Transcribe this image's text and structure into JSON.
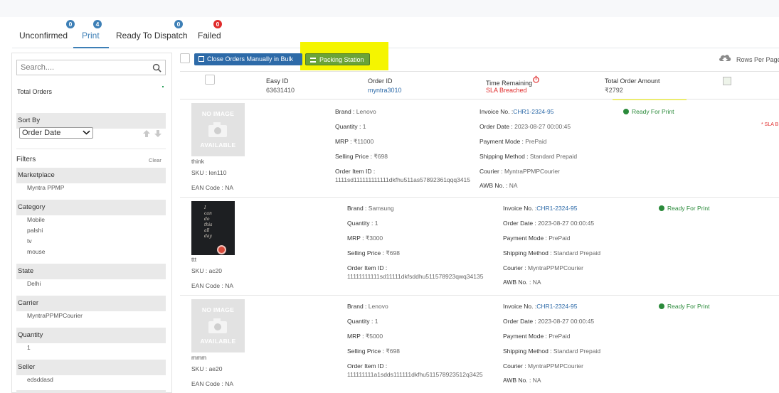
{
  "tabs": [
    {
      "label": "Unconfirmed",
      "count": "0",
      "color": "#3d7fb6"
    },
    {
      "label": "Print",
      "count": "4",
      "color": "#3d7fb6",
      "active": true
    },
    {
      "label": "Ready To Dispatch",
      "count": "0",
      "color": "#3d7fb6"
    },
    {
      "label": "Failed",
      "count": "0",
      "color": "#e02b2b"
    }
  ],
  "sidebar": {
    "search_placeholder": "Search....",
    "total_orders_label": "Total Orders",
    "sort_by_label": "Sort By",
    "sort_value": "Order Date",
    "filters_label": "Filters",
    "clear_label": "Clear",
    "groups": [
      {
        "title": "Marketplace",
        "items": [
          "Myntra PPMP"
        ]
      },
      {
        "title": "Category",
        "items": [
          "Mobile",
          "palshi",
          "tv",
          "mouse"
        ]
      },
      {
        "title": "State",
        "items": [
          "Delhi"
        ]
      },
      {
        "title": "Carrier",
        "items": [
          "MyntraPPMPCourier"
        ]
      },
      {
        "title": "Quantity",
        "items": [
          "1"
        ]
      },
      {
        "title": "Seller",
        "items": [
          "edsddasd"
        ]
      }
    ]
  },
  "toolbar": {
    "close_bulk_label": "Close Orders Manually in Bulk",
    "packing_station_label": "Packing Station",
    "rows_per_page_label": "Rows Per Page"
  },
  "order": {
    "easy_id_label": "Easy ID",
    "easy_id": "63631410",
    "order_id_label": "Order ID",
    "order_id": "myntra3010",
    "time_remaining_label": "Time Remaining",
    "time_remaining_value": "SLA Breached",
    "total_amount_label": "Total Order Amount",
    "total_amount": "₹2792"
  },
  "labels": {
    "brand": "Brand : ",
    "quantity": "Quantity : ",
    "mrp": "MRP : ",
    "selling_price": "Selling Price : ",
    "order_item_id": "Order Item ID :",
    "invoice": "Invoice No. :",
    "order_date": "Order Date : ",
    "payment_mode": "Payment Mode : ",
    "shipping_method": "Shipping Method : ",
    "courier": "Courier : ",
    "awb": "AWB No. : ",
    "sku": "SKU : ",
    "ean": "EAN Code : ",
    "no_image_top": "NO IMAGE",
    "no_image_bottom": "AVAILABLE"
  },
  "items": [
    {
      "name": "think",
      "sku": "len110",
      "ean": "NA",
      "brand": "Lenovo",
      "quantity": "1",
      "mrp": "₹11000",
      "selling_price": "₹698",
      "order_item_id": "1111sd111111111111dkfhu511as57892361qqq3415",
      "invoice": "CHR1-2324-95",
      "order_date": "2023-08-27 00:00:45",
      "payment_mode": "PrePaid",
      "shipping_method": "Standard Prepaid",
      "courier": "MyntraPPMPCourier",
      "awb": "NA",
      "status": "Ready For Print",
      "sla_note": "* SLA B"
    },
    {
      "name": "ttt",
      "sku": "ac20",
      "ean": "NA",
      "brand": "Samsung",
      "quantity": "1",
      "mrp": "₹3000",
      "selling_price": "₹698",
      "order_item_id": "11111111111sd11111dkfsddhu511578923qwq34135",
      "invoice": "CHR1-2324-95",
      "order_date": "2023-08-27 00:00:45",
      "payment_mode": "PrePaid",
      "shipping_method": "Standard Prepaid",
      "courier": "MyntraPPMPCourier",
      "awb": "NA",
      "status": "Ready For Print",
      "photo_text": "I\ncan\ndo\nthis\nall\nday"
    },
    {
      "name": "mmm",
      "sku": "ae20",
      "ean": "NA",
      "brand": "Lenovo",
      "quantity": "1",
      "mrp": "₹5000",
      "selling_price": "₹698",
      "order_item_id": "111111111a1sdds111111dkfhu511578923512q3425",
      "invoice": "CHR1-2324-95",
      "order_date": "2023-08-27 00:00:45",
      "payment_mode": "PrePaid",
      "shipping_method": "Standard Prepaid",
      "courier": "MyntraPPMPCourier",
      "awb": "NA",
      "status": "Ready For Print"
    }
  ]
}
